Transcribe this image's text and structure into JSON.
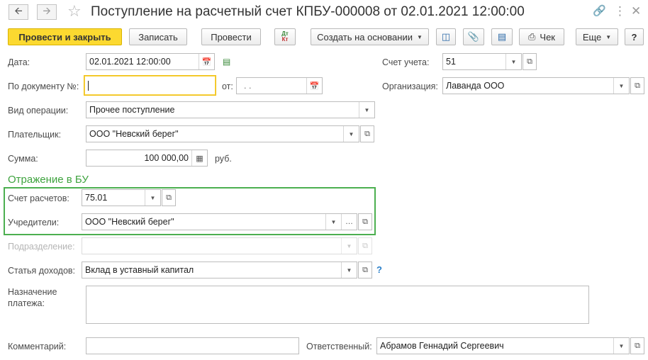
{
  "window": {
    "title": "Поступление на расчетный счет КПБУ-000008 от 02.01.2021 12:00:00",
    "back_icon": "arrow-left-icon",
    "forward_icon": "arrow-right-icon"
  },
  "toolbar": {
    "post_close": "Провести и закрыть",
    "save": "Записать",
    "post": "Провести",
    "dt_kt_top": "Дт",
    "dt_kt_bottom": "Кт",
    "create_based": "Создать на основании",
    "receipt": "Чек",
    "more": "Еще",
    "help": "?"
  },
  "form": {
    "date": {
      "label": "Дата:",
      "value": "02.01.2021 12:00:00"
    },
    "doc_number": {
      "label": "По документу №:",
      "value": ""
    },
    "from": {
      "label": "от:",
      "value": " .  . "
    },
    "account": {
      "label": "Счет учета:",
      "value": "51"
    },
    "organization": {
      "label": "Организация:",
      "value": "Лаванда ООО"
    },
    "operation": {
      "label": "Вид операции:",
      "value": "Прочее поступление"
    },
    "payer": {
      "label": "Плательщик:",
      "value": "ООО \"Невский берег\""
    },
    "amount": {
      "label": "Сумма:",
      "value": "100 000,00",
      "currency": "руб."
    },
    "section_title": "Отражение в БУ",
    "settlement_account": {
      "label": "Счет расчетов:",
      "value": "75.01"
    },
    "founders": {
      "label": "Учредители:",
      "value": "ООО \"Невский берег\""
    },
    "department": {
      "label": "Подразделение:",
      "value": ""
    },
    "income_item": {
      "label": "Статья доходов:",
      "value": "Вклад в уставный капитал",
      "help": "?"
    },
    "purpose": {
      "label_line1": "Назначение",
      "label_line2": "платежа:",
      "value": ""
    },
    "comment": {
      "label": "Комментарий:",
      "value": ""
    },
    "responsible": {
      "label": "Ответственный:",
      "value": "Абрамов Геннадий Сергеевич"
    }
  }
}
